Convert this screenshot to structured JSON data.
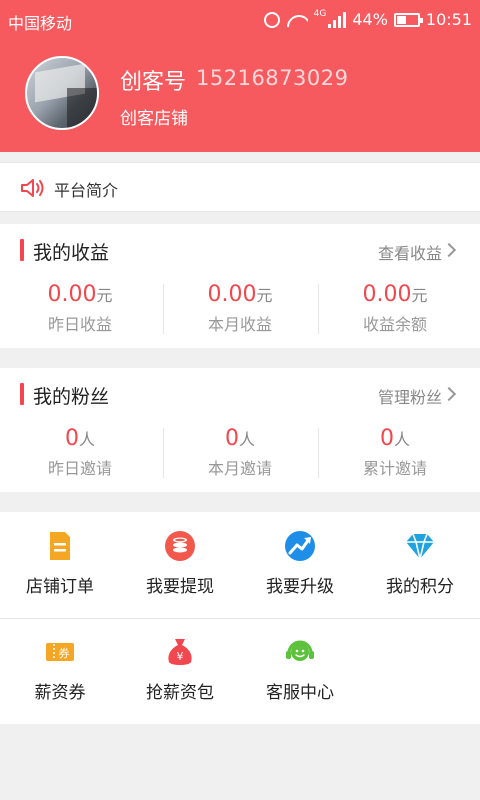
{
  "status_bar": {
    "carrier": "中国移动",
    "network": "4G",
    "battery": "44%",
    "battery_level": 0.44,
    "time": "10:51"
  },
  "profile": {
    "name": "创客号",
    "phone": "15216873029",
    "shop": "创客店铺"
  },
  "intro": {
    "label": "平台简介",
    "icon": "speaker-icon"
  },
  "earnings": {
    "title": "我的收益",
    "link": "查看收益",
    "accent": "#f2474e",
    "stats": [
      {
        "value": "0.00",
        "unit": "元",
        "label": "昨日收益"
      },
      {
        "value": "0.00",
        "unit": "元",
        "label": "本月收益"
      },
      {
        "value": "0.00",
        "unit": "元",
        "label": "收益余额"
      }
    ]
  },
  "fans": {
    "title": "我的粉丝",
    "link": "管理粉丝",
    "stats": [
      {
        "value": "0",
        "unit": "人",
        "label": "昨日邀请"
      },
      {
        "value": "0",
        "unit": "人",
        "label": "本月邀请"
      },
      {
        "value": "0",
        "unit": "人",
        "label": "累计邀请"
      }
    ]
  },
  "menu": [
    {
      "label": "店铺订单",
      "icon": "order-document-icon",
      "color": "#f5a623"
    },
    {
      "label": "我要提现",
      "icon": "coins-icon",
      "color": "#f2584c"
    },
    {
      "label": "我要升级",
      "icon": "upgrade-trend-icon",
      "color": "#1f8ee8"
    },
    {
      "label": "我的积分",
      "icon": "diamond-icon",
      "color": "#1fa2e0"
    },
    {
      "label": "薪资券",
      "icon": "coupon-icon",
      "color": "#f5a623",
      "icon_text": "券"
    },
    {
      "label": "抢薪资包",
      "icon": "money-bag-icon",
      "color": "#f2474e",
      "icon_text": "¥"
    },
    {
      "label": "客服中心",
      "icon": "customer-service-icon",
      "color": "#5cc13b"
    }
  ],
  "colors": {
    "header_bg": "#f65a5f",
    "page_bg": "#f0f0f0"
  }
}
